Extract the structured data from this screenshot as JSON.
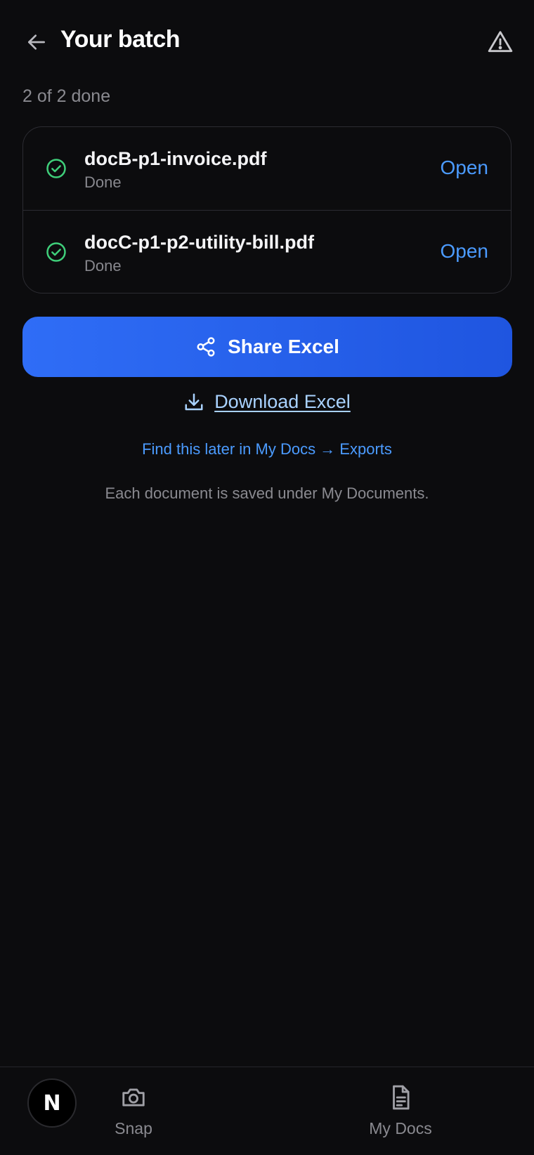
{
  "header": {
    "title": "Your batch",
    "back_icon": "arrow-left-icon",
    "report_icon": "warning-triangle-icon"
  },
  "progress": {
    "text": "2 of 2 done"
  },
  "files": [
    {
      "name": "docB-p1-invoice.pdf",
      "status": "Done",
      "action": "Open"
    },
    {
      "name": "docC-p1-p2-utility-bill.pdf",
      "status": "Done",
      "action": "Open"
    }
  ],
  "actions": {
    "share_label": "Share Excel",
    "share_icon": "share-icon",
    "download_label": "Download Excel",
    "download_icon": "download-icon",
    "later_link": "Find this later in My Docs → Exports",
    "footnote": "Each document is saved under My Documents."
  },
  "bottom_nav": {
    "avatar_letter": "N",
    "snap_label": "Snap",
    "snap_icon": "camera-icon",
    "docs_label": "My Docs",
    "docs_icon": "document-icon"
  },
  "colors": {
    "background": "#0c0c0e",
    "accent": "#2f6df6",
    "link": "#4b9bff",
    "success": "#3fcf7a"
  }
}
